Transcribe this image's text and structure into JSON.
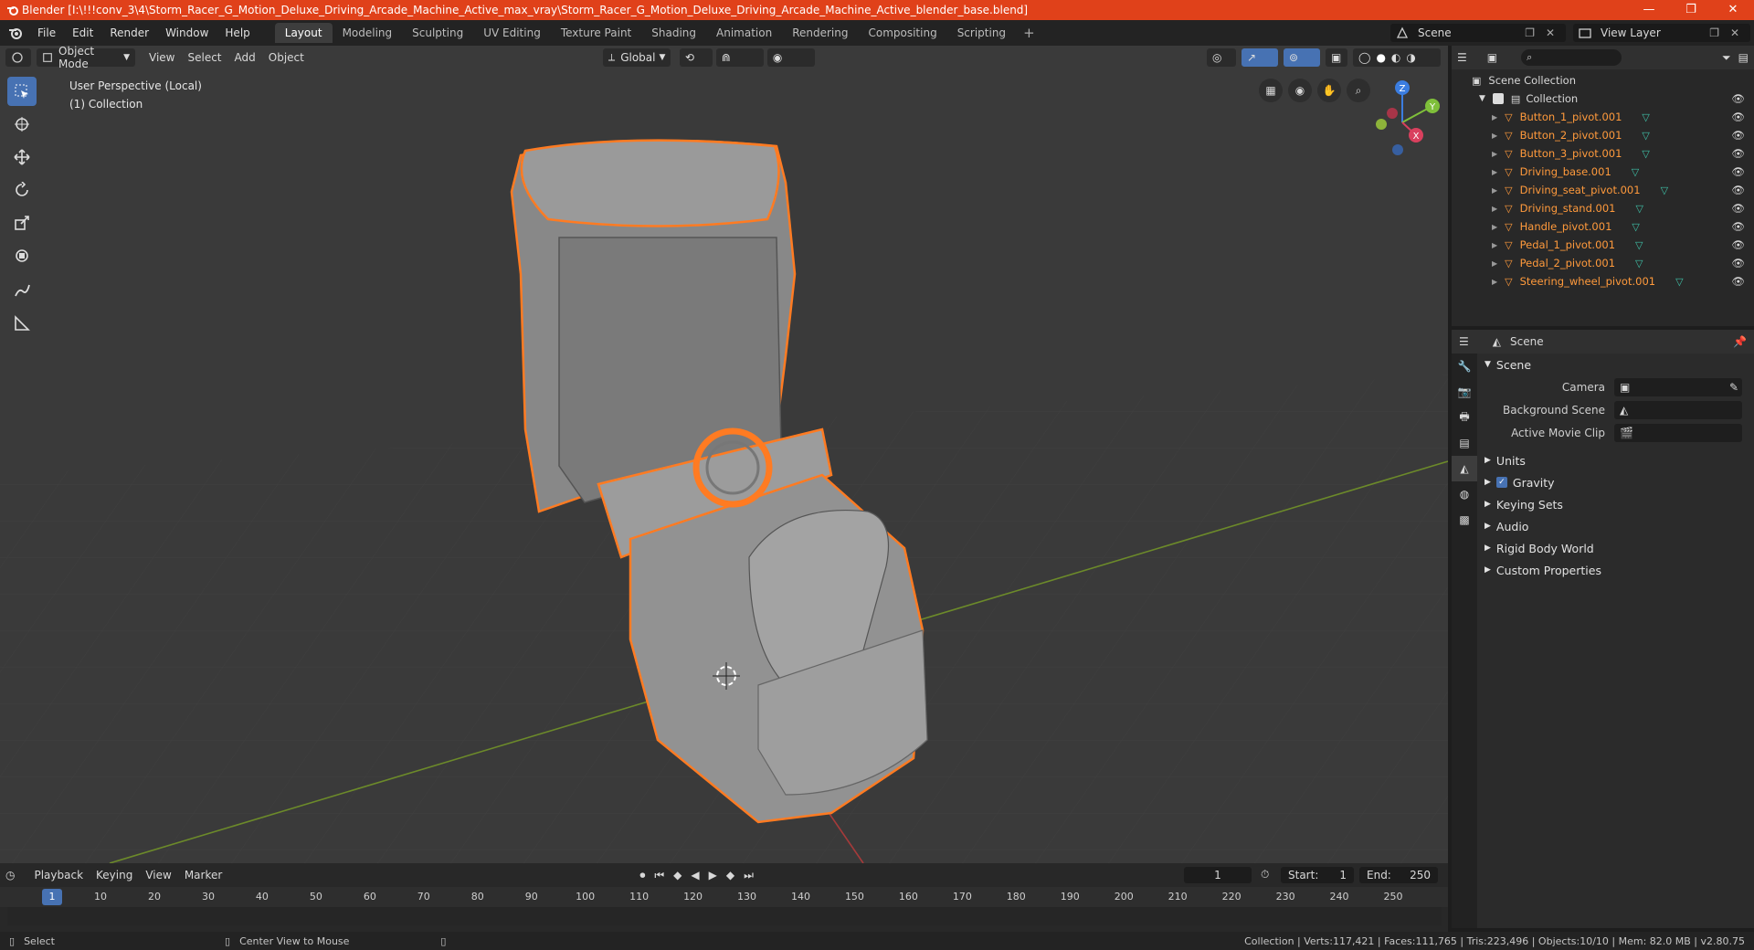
{
  "window": {
    "title": "Blender [I:\\!!!conv_3\\4\\Storm_Racer_G_Motion_Deluxe_Driving_Arcade_Machine_Active_max_vray\\Storm_Racer_G_Motion_Deluxe_Driving_Arcade_Machine_Active_blender_base.blend]",
    "controls": [
      "—",
      "❐",
      "✕"
    ]
  },
  "menu": [
    "File",
    "Edit",
    "Render",
    "Window",
    "Help"
  ],
  "workspaces": [
    "Layout",
    "Modeling",
    "Sculpting",
    "UV Editing",
    "Texture Paint",
    "Shading",
    "Animation",
    "Rendering",
    "Compositing",
    "Scripting"
  ],
  "active_workspace": "Layout",
  "scene_name": "Scene",
  "view_layer": "View Layer",
  "viewport": {
    "mode": "Object Mode",
    "menus": [
      "View",
      "Select",
      "Add",
      "Object"
    ],
    "orientation": "Global",
    "perspective": "User Perspective (Local)",
    "collection": "(1) Collection",
    "gizmo_axes": [
      "Z",
      "Y",
      "X"
    ]
  },
  "outliner": {
    "root": "Scene Collection",
    "collection": "Collection",
    "items": [
      "Button_1_pivot.001",
      "Button_2_pivot.001",
      "Button_3_pivot.001",
      "Driving_base.001",
      "Driving_seat_pivot.001",
      "Driving_stand.001",
      "Handle_pivot.001",
      "Pedal_1_pivot.001",
      "Pedal_2_pivot.001",
      "Steering_wheel_pivot.001"
    ]
  },
  "properties": {
    "header": "Scene",
    "section": "Scene",
    "fields": [
      {
        "label": "Camera",
        "value": ""
      },
      {
        "label": "Background Scene",
        "value": ""
      },
      {
        "label": "Active Movie Clip",
        "value": ""
      }
    ],
    "panels": [
      "Units",
      "Gravity",
      "Keying Sets",
      "Audio",
      "Rigid Body World",
      "Custom Properties"
    ]
  },
  "timeline": {
    "menus": [
      "Playback",
      "Keying",
      "View",
      "Marker"
    ],
    "current_frame": "1",
    "start_label": "Start:",
    "start": "1",
    "end_label": "End:",
    "end": "250",
    "ruler": [
      "1",
      "10",
      "20",
      "30",
      "40",
      "50",
      "60",
      "70",
      "80",
      "90",
      "100",
      "110",
      "120",
      "130",
      "140",
      "150",
      "160",
      "170",
      "180",
      "190",
      "200",
      "210",
      "220",
      "230",
      "240",
      "250"
    ]
  },
  "status": {
    "left": "Select",
    "middle": "Center View to Mouse",
    "right": "Collection | Verts:117,421 | Faces:111,765 | Tris:223,496 | Objects:10/10 | Mem: 82.0 MB | v2.80.75"
  },
  "colors": {
    "accent": "#4772b3",
    "title": "#e0411a",
    "selection": "#ff7b22",
    "mesh_icon": "#3fc0a7"
  }
}
